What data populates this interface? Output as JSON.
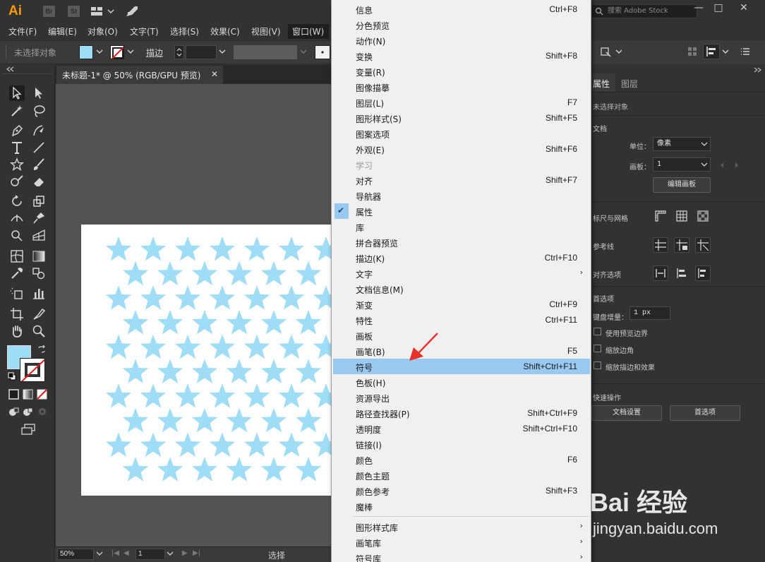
{
  "app": {
    "logo": "Ai",
    "bridge": "Br",
    "stock": "St",
    "search_placeholder": "搜索 Adobe Stock"
  },
  "menubar": {
    "items": [
      "文件(F)",
      "编辑(E)",
      "对象(O)",
      "文字(T)",
      "选择(S)",
      "效果(C)",
      "视图(V)",
      "窗口(W)"
    ]
  },
  "controlbar": {
    "no_selection": "未选择对象",
    "stroke_label": "描边",
    "fill_color": "#9fdcf5"
  },
  "document": {
    "tab_title": "未标题-1* @ 50% (RGB/GPU 预览)"
  },
  "statusbar": {
    "zoom": "50%",
    "page": "1",
    "tool_status": "选择"
  },
  "window_menu": {
    "items": [
      {
        "label": "信息",
        "shortcut": "Ctrl+F8"
      },
      {
        "label": "分色预览",
        "shortcut": ""
      },
      {
        "label": "动作(N)",
        "shortcut": ""
      },
      {
        "label": "变换",
        "shortcut": "Shift+F8"
      },
      {
        "label": "变量(R)",
        "shortcut": ""
      },
      {
        "label": "图像描摹",
        "shortcut": ""
      },
      {
        "label": "图层(L)",
        "shortcut": "F7"
      },
      {
        "label": "图形样式(S)",
        "shortcut": "Shift+F5"
      },
      {
        "label": "图案选项",
        "shortcut": ""
      },
      {
        "label": "外观(E)",
        "shortcut": "Shift+F6"
      },
      {
        "label": "学习",
        "shortcut": "",
        "disabled": true
      },
      {
        "label": "对齐",
        "shortcut": "Shift+F7"
      },
      {
        "label": "导航器",
        "shortcut": ""
      },
      {
        "label": "属性",
        "shortcut": "",
        "checked": true
      },
      {
        "label": "库",
        "shortcut": ""
      },
      {
        "label": "拼合器预览",
        "shortcut": ""
      },
      {
        "label": "描边(K)",
        "shortcut": "Ctrl+F10"
      },
      {
        "label": "文字",
        "shortcut": "",
        "submenu": true
      },
      {
        "label": "文档信息(M)",
        "shortcut": ""
      },
      {
        "label": "渐变",
        "shortcut": "Ctrl+F9"
      },
      {
        "label": "特性",
        "shortcut": "Ctrl+F11"
      },
      {
        "label": "画板",
        "shortcut": ""
      },
      {
        "label": "画笔(B)",
        "shortcut": "F5"
      },
      {
        "label": "符号",
        "shortcut": "Shift+Ctrl+F11",
        "highlighted": true
      },
      {
        "label": "色板(H)",
        "shortcut": ""
      },
      {
        "label": "资源导出",
        "shortcut": ""
      },
      {
        "label": "路径查找器(P)",
        "shortcut": "Shift+Ctrl+F9"
      },
      {
        "label": "透明度",
        "shortcut": "Shift+Ctrl+F10"
      },
      {
        "label": "链接(I)",
        "shortcut": ""
      },
      {
        "label": "颜色",
        "shortcut": "F6"
      },
      {
        "label": "颜色主题",
        "shortcut": ""
      },
      {
        "label": "颜色参考",
        "shortcut": "Shift+F3"
      },
      {
        "label": "魔棒",
        "shortcut": ""
      }
    ],
    "library_items": [
      {
        "label": "图形样式库",
        "submenu": true
      },
      {
        "label": "画笔库",
        "submenu": true
      },
      {
        "label": "符号库",
        "submenu": true
      }
    ],
    "submenu_arrow": "›",
    "checkmark": "✔",
    "highlight_color": "#99c9f0"
  },
  "properties_panel": {
    "tabs": [
      "属性",
      "图层"
    ],
    "no_selection": "未选择对象",
    "document_section": "文档",
    "units_label": "单位：",
    "units_value": "像素",
    "artboard_label": "画板：",
    "artboard_value": "1",
    "edit_artboards_button": "编辑画板",
    "rulers_grids": "标尺与网格",
    "guides": "参考线",
    "snap_options": "对齐选项",
    "preferences_section": "首选项",
    "keyboard_increment_label": "键盘增量：",
    "keyboard_increment_value": "1 px",
    "use_preview_bounds": "使用预览边界",
    "scale_corners": "缩放边角",
    "scale_strokes_effects": "缩放描边和效果",
    "quick_actions": "快速操作",
    "document_setup_button": "文档设置",
    "preferences_button": "首选项"
  },
  "watermark": {
    "logo": "Bai 经验",
    "url": "jingyan.baidu.com"
  },
  "colors": {
    "star": "#9fdcf5",
    "arrow": "#e8312a"
  }
}
